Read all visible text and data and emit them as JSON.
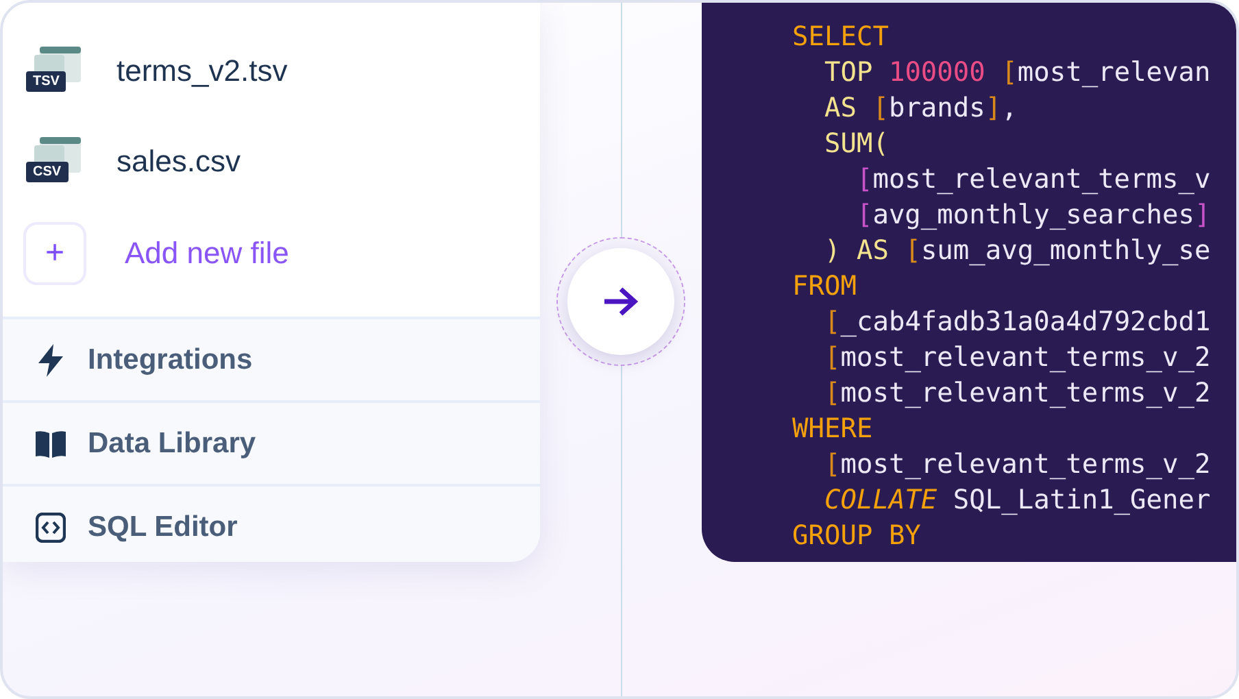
{
  "files": [
    {
      "name": "terms_v2.tsv",
      "badge": "TSV"
    },
    {
      "name": "sales.csv",
      "badge": "CSV"
    }
  ],
  "add_file": {
    "icon": "+",
    "label": "Add new file"
  },
  "nav": [
    {
      "label": "Integrations"
    },
    {
      "label": "Data Library"
    },
    {
      "label": "SQL Editor"
    }
  ],
  "code": {
    "lines": [
      {
        "tokens": [
          {
            "kind": "clause",
            "text": "SELECT"
          }
        ]
      },
      {
        "tokens": [
          {
            "kind": "keyword",
            "text": "  TOP "
          },
          {
            "kind": "number",
            "text": "100000"
          },
          {
            "kind": "bracket",
            "text": " ["
          },
          {
            "kind": "ident",
            "text": "most_relevan"
          }
        ]
      },
      {
        "tokens": [
          {
            "kind": "keyword",
            "text": "  AS "
          },
          {
            "kind": "bracket",
            "text": "["
          },
          {
            "kind": "ident",
            "text": "brands"
          },
          {
            "kind": "bracket",
            "text": "]"
          },
          {
            "kind": "ident",
            "text": ","
          }
        ]
      },
      {
        "tokens": [
          {
            "kind": "keyword",
            "text": "  SUM("
          }
        ]
      },
      {
        "tokens": [
          {
            "kind": "inner_bracket",
            "text": "    ["
          },
          {
            "kind": "ident",
            "text": "most_relevant_terms_v"
          }
        ]
      },
      {
        "tokens": [
          {
            "kind": "inner_bracket",
            "text": "    ["
          },
          {
            "kind": "ident",
            "text": "avg_monthly_searches"
          },
          {
            "kind": "inner_bracket",
            "text": "]"
          }
        ]
      },
      {
        "tokens": [
          {
            "kind": "keyword",
            "text": "  ) AS "
          },
          {
            "kind": "bracket",
            "text": "["
          },
          {
            "kind": "ident",
            "text": "sum_avg_monthly_se"
          }
        ]
      },
      {
        "tokens": [
          {
            "kind": "clause",
            "text": "FROM"
          }
        ]
      },
      {
        "tokens": [
          {
            "kind": "bracket",
            "text": "  ["
          },
          {
            "kind": "ident",
            "text": "_cab4fadb31a0a4d792cbd1"
          }
        ]
      },
      {
        "tokens": [
          {
            "kind": "bracket",
            "text": "  ["
          },
          {
            "kind": "ident",
            "text": "most_relevant_terms_v_2"
          }
        ]
      },
      {
        "tokens": [
          {
            "kind": "bracket",
            "text": "  ["
          },
          {
            "kind": "ident",
            "text": "most_relevant_terms_v_2"
          }
        ]
      },
      {
        "tokens": [
          {
            "kind": "clause",
            "text": "WHERE"
          }
        ]
      },
      {
        "tokens": [
          {
            "kind": "bracket",
            "text": "  ["
          },
          {
            "kind": "ident",
            "text": "most_relevant_terms_v_2"
          }
        ]
      },
      {
        "tokens": [
          {
            "kind": "modifier",
            "text": "  COLLATE "
          },
          {
            "kind": "ident",
            "text": "SQL_Latin1_Gener"
          }
        ]
      },
      {
        "tokens": [
          {
            "kind": "clause",
            "text": "GROUP BY"
          }
        ]
      }
    ]
  }
}
